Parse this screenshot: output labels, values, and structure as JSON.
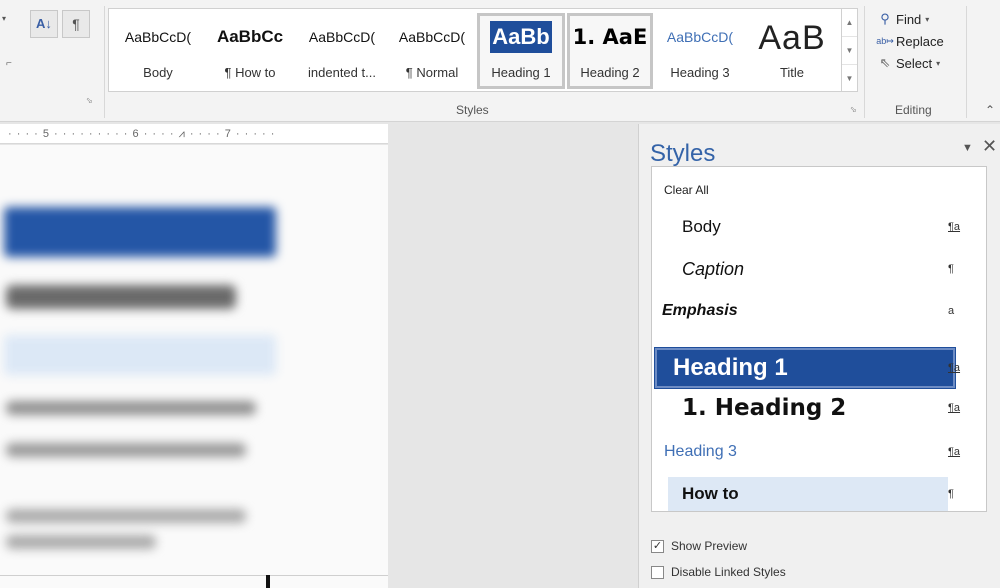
{
  "ribbon": {
    "sort_icon": "sort-az-icon",
    "pilcrow": "¶",
    "styles_gallery": [
      {
        "preview": "AaBbCcD(",
        "name": "Body"
      },
      {
        "preview": "AaBbCc",
        "name": "¶ How to"
      },
      {
        "preview": "AaBbCcD(",
        "name": "indented t..."
      },
      {
        "preview": "AaBbCcD(",
        "name": "¶ Normal"
      },
      {
        "preview": "AaBb",
        "name": "Heading 1"
      },
      {
        "preview": "1. AaE",
        "name": "Heading 2"
      },
      {
        "preview": "AaBbCcD(",
        "name": "Heading 3"
      },
      {
        "preview": "AaB",
        "name": "Title"
      }
    ],
    "styles_group_label": "Styles",
    "editing": {
      "find": "Find",
      "replace": "Replace",
      "select": "Select",
      "group_label": "Editing"
    }
  },
  "ruler": {
    "text": "· · · · 5 · · · · · · · · · 6 · · · · ⩘ · · · · 7 · · · · ·"
  },
  "styles_pane": {
    "title": "Styles",
    "items": [
      {
        "name": "Clear All",
        "mark": ""
      },
      {
        "name": "Body",
        "mark": "¶a"
      },
      {
        "name": "Caption",
        "mark": "¶"
      },
      {
        "name": "Emphasis",
        "mark": "a"
      },
      {
        "name": "Heading 1",
        "mark": "¶a"
      },
      {
        "name": "1.  Heading 2",
        "mark": "¶a"
      },
      {
        "name": "Heading 3",
        "mark": "¶a"
      },
      {
        "name": "How to",
        "mark": "¶"
      }
    ],
    "show_preview": {
      "label": "Show Preview",
      "checked": true
    },
    "disable_linked": {
      "label": "Disable Linked Styles",
      "checked": false
    }
  }
}
